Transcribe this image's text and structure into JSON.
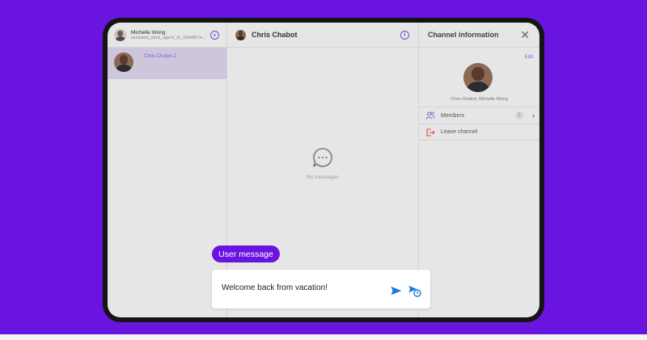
{
  "sidebar": {
    "current_user": {
      "name": "Michelle Wong",
      "subtitle": "assistant_desk_agent_id_15bd9b7e..."
    },
    "channels": [
      {
        "name": "Chris Chabot 2",
        "selected": true
      }
    ]
  },
  "chat": {
    "title": "Chris Chabot",
    "empty_state": "No messages"
  },
  "info_panel": {
    "title": "Channel information",
    "edit_label": "Edit",
    "members_names": "Chris Chabot, Michelle Wong",
    "members_label": "Members",
    "members_count": "2",
    "leave_label": "Leave channel"
  },
  "overlay": {
    "pill_label": "User message",
    "composer_text": "Welcome back from vacation!"
  },
  "colors": {
    "background": "#6a14e0",
    "accent": "#8860d0",
    "send": "#1a7bd8",
    "leave": "#e04848"
  },
  "icons": [
    "new-chat-icon",
    "info-icon",
    "close-icon",
    "chat-bubble-icon",
    "members-icon",
    "leave-icon",
    "chevron-right-icon",
    "send-icon",
    "schedule-send-icon"
  ]
}
